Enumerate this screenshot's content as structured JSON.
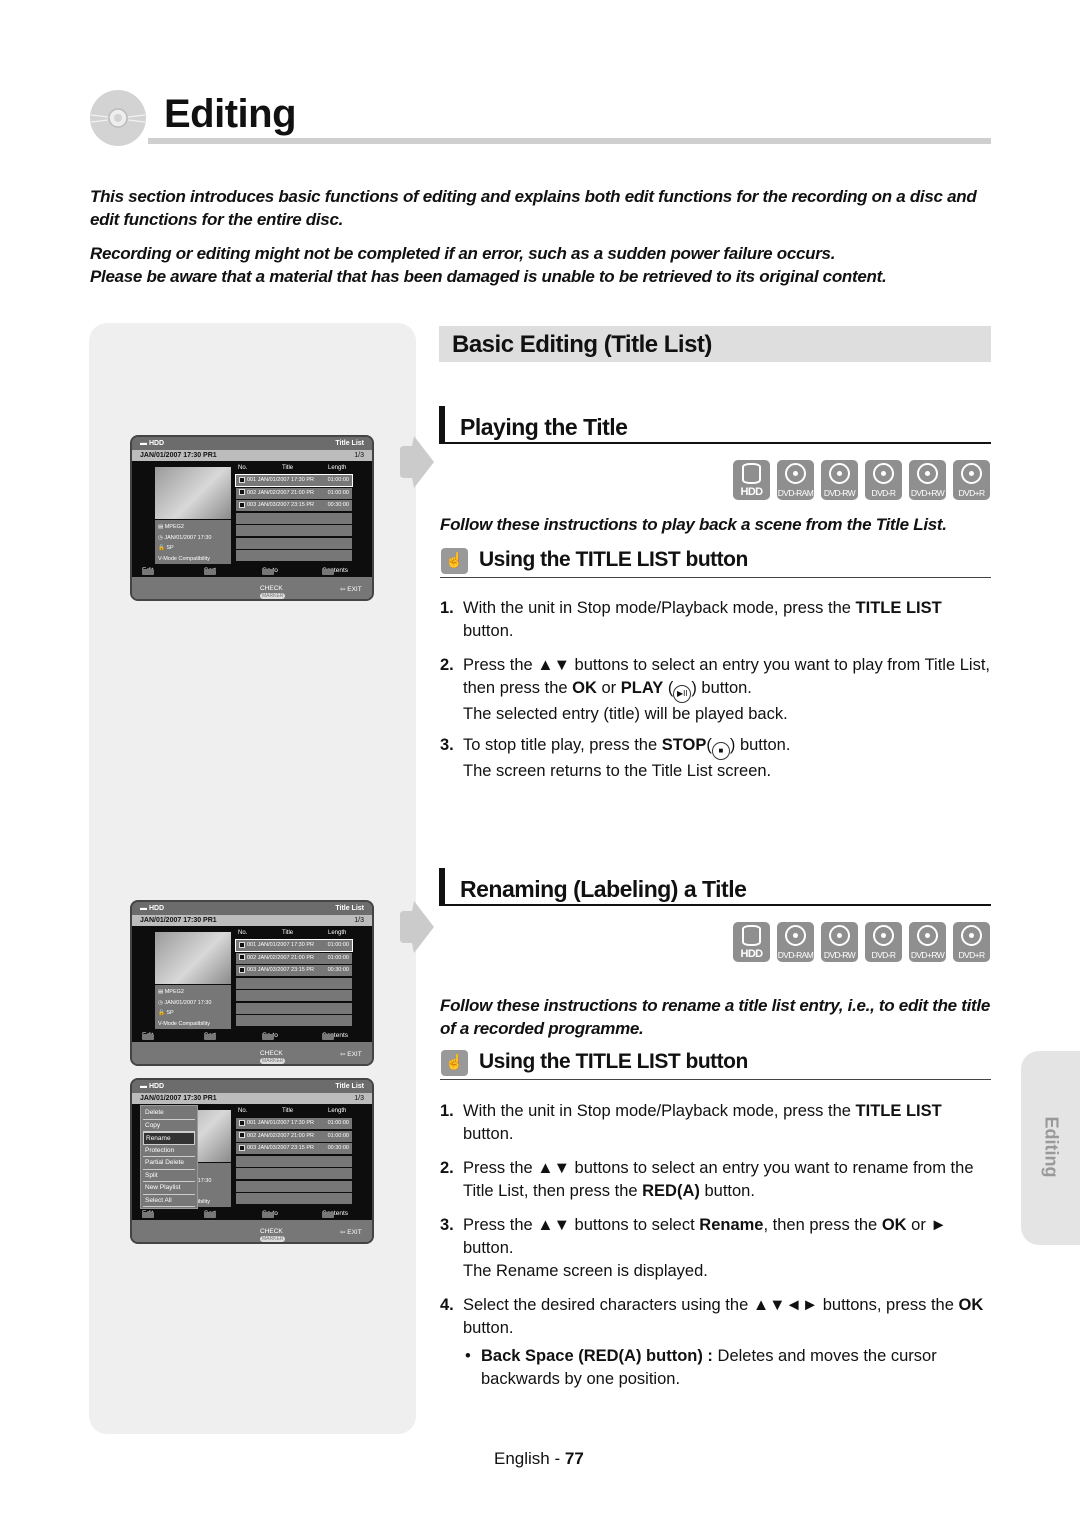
{
  "header": {
    "title": "Editing",
    "icon": "disc-icon"
  },
  "intro": {
    "paragraph1": "This section introduces basic functions of editing and explains both edit functions for the recording on a disc and edit functions for the entire disc.",
    "paragraph2_line1": "Recording or editing might not be completed if an error, such as a sudden power failure occurs.",
    "paragraph2_line2": "Please be aware that a material that has been damaged is unable to be retrieved to its original content."
  },
  "section": {
    "title": "Basic Editing (Title List)"
  },
  "media_badges": [
    "HDD",
    "DVD-RAM",
    "DVD-RW",
    "DVD-R",
    "DVD+RW",
    "DVD+R"
  ],
  "playing": {
    "title": "Playing the Title",
    "follow": "Follow these instructions to play back a scene from the Title List.",
    "subheading": "Using the TITLE LIST button",
    "steps": [
      {
        "num": "1.",
        "pre": "With the unit in Stop mode/Playback mode, press the ",
        "b1": "TITLE LIST",
        "post": " button."
      },
      {
        "num": "2.",
        "pre": "Press the ▲▼ buttons to select an entry you want to play from Title List, then press the ",
        "b1": "OK",
        "mid": " or ",
        "b2": "PLAY",
        "post": " (",
        "icon": "▶II",
        "post2": ") button.",
        "note": "The selected entry (title) will be played back."
      },
      {
        "num": "3.",
        "pre": "To stop title play, press the ",
        "b1": "STOP",
        "post": "(",
        "icon": "■",
        "post2": ") button.",
        "note": "The screen returns to the Title List screen."
      }
    ]
  },
  "renaming": {
    "title": "Renaming (Labeling) a Title",
    "follow": "Follow these instructions to rename a title list entry, i.e., to edit the title of a recorded programme.",
    "subheading": "Using the TITLE LIST button",
    "steps": [
      {
        "num": "1.",
        "pre": "With the unit in Stop mode/Playback mode, press the ",
        "b1": "TITLE LIST",
        "post": " button."
      },
      {
        "num": "2.",
        "pre": "Press the ▲▼ buttons to select an entry you want to rename from the Title List, then press the ",
        "b1": "RED(A)",
        "post": " button."
      },
      {
        "num": "3.",
        "pre": "Press the ▲▼ buttons to select ",
        "b1": "Rename",
        "mid": ", then press the ",
        "b2": "OK",
        "post": " or ► button.",
        "note": "The Rename screen is displayed."
      },
      {
        "num": "4.",
        "pre": "Select the desired characters using the ▲▼◄► buttons, press the ",
        "b1": "OK",
        "post": " button."
      }
    ],
    "bullet": {
      "bold": "Back Space (RED(A) button) :",
      "text": " Deletes and moves the cursor backwards by one position."
    }
  },
  "tv_screen": {
    "source": "HDD",
    "title_list": "Title List",
    "date_channel": "JAN/01/2007 17:30 PR1",
    "page": "1/3",
    "col_no": "No.",
    "col_title": "Title",
    "col_length": "Length",
    "rows": [
      {
        "no": "001",
        "title": "JAN/01/2007 17:30 PR",
        "length": "01:00:00"
      },
      {
        "no": "002",
        "title": "JAN/02/2007 21:00 PR",
        "length": "01:00:00"
      },
      {
        "no": "003",
        "title": "JAN/03/2007 23:15 PR",
        "length": "00:30:00"
      }
    ],
    "info": {
      "codec": "MPEG2",
      "time": "JAN/01/2007 17:30",
      "mode": "SP",
      "compat": "V-Mode Compatibility"
    },
    "footer": {
      "a_key": "A",
      "a": "Edit",
      "b_key": "B",
      "b": "Sort",
      "c_key": "C",
      "c": "Go to",
      "d_key": "D",
      "d": "Contents",
      "marker": "MARKER",
      "check": "CHECK",
      "exit": "EXIT"
    },
    "edit_menu": [
      "Delete",
      "Copy",
      "Rename",
      "Protection",
      "Partial Delete",
      "Split",
      "New Playlist",
      "Select All"
    ],
    "edit_menu_selected": "Rename"
  },
  "side_tab": "Editing",
  "footer": {
    "lang": "English",
    "sep": " - ",
    "page": "77"
  }
}
